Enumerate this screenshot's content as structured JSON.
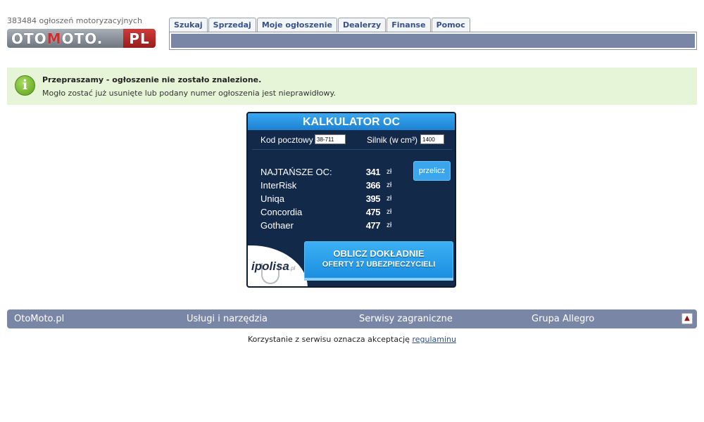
{
  "header": {
    "ad_count_text": "383484 ogłoszeń motoryzacyjnych",
    "logo": {
      "part1": "OTO",
      "part2": "M",
      "part3": "OTO.",
      "part4": "PL"
    }
  },
  "tabs": [
    "Szukaj",
    "Sprzedaj",
    "Moje ogłoszenie",
    "Dealerzy",
    "Finanse",
    "Pomoc"
  ],
  "notice": {
    "icon": "info-icon",
    "title": "Przepraszamy - ogłoszenie nie zostało znalezione.",
    "message": "Mogło zostać już usunięte lub podany numer ogłoszenia jest nieprawidłowy."
  },
  "calculator": {
    "title": "KALKULATOR OC",
    "postal_label": "Kod pocztowy",
    "postal_value": "38-711",
    "engine_label": "Silnik (w cm³)",
    "engine_value": "1400",
    "recalc_label": "przelicz",
    "rates": [
      {
        "name": "NAJTAŃSZE OC:",
        "price": "341",
        "currency": "zł"
      },
      {
        "name": "InterRisk",
        "price": "366",
        "currency": "zł"
      },
      {
        "name": "Uniqa",
        "price": "395",
        "currency": "zł"
      },
      {
        "name": "Concordia",
        "price": "475",
        "currency": "zł"
      },
      {
        "name": "Gothaer",
        "price": "477",
        "currency": "zł"
      }
    ],
    "partner_brand": "ipolisa",
    "partner_suffix": ".pl",
    "cta_line1": "OBLICZ DOKŁADNIE",
    "cta_line2": "OFERTY 17 UBEZPIECZYCIELI"
  },
  "footer": {
    "links": [
      "OtoMoto.pl",
      "Usługi i narzędzia",
      "Serwisy zagraniczne",
      "Grupa Allegro"
    ],
    "legal_text": "Korzystanie z serwisu oznacza akceptację",
    "legal_link": "regulaminu"
  }
}
